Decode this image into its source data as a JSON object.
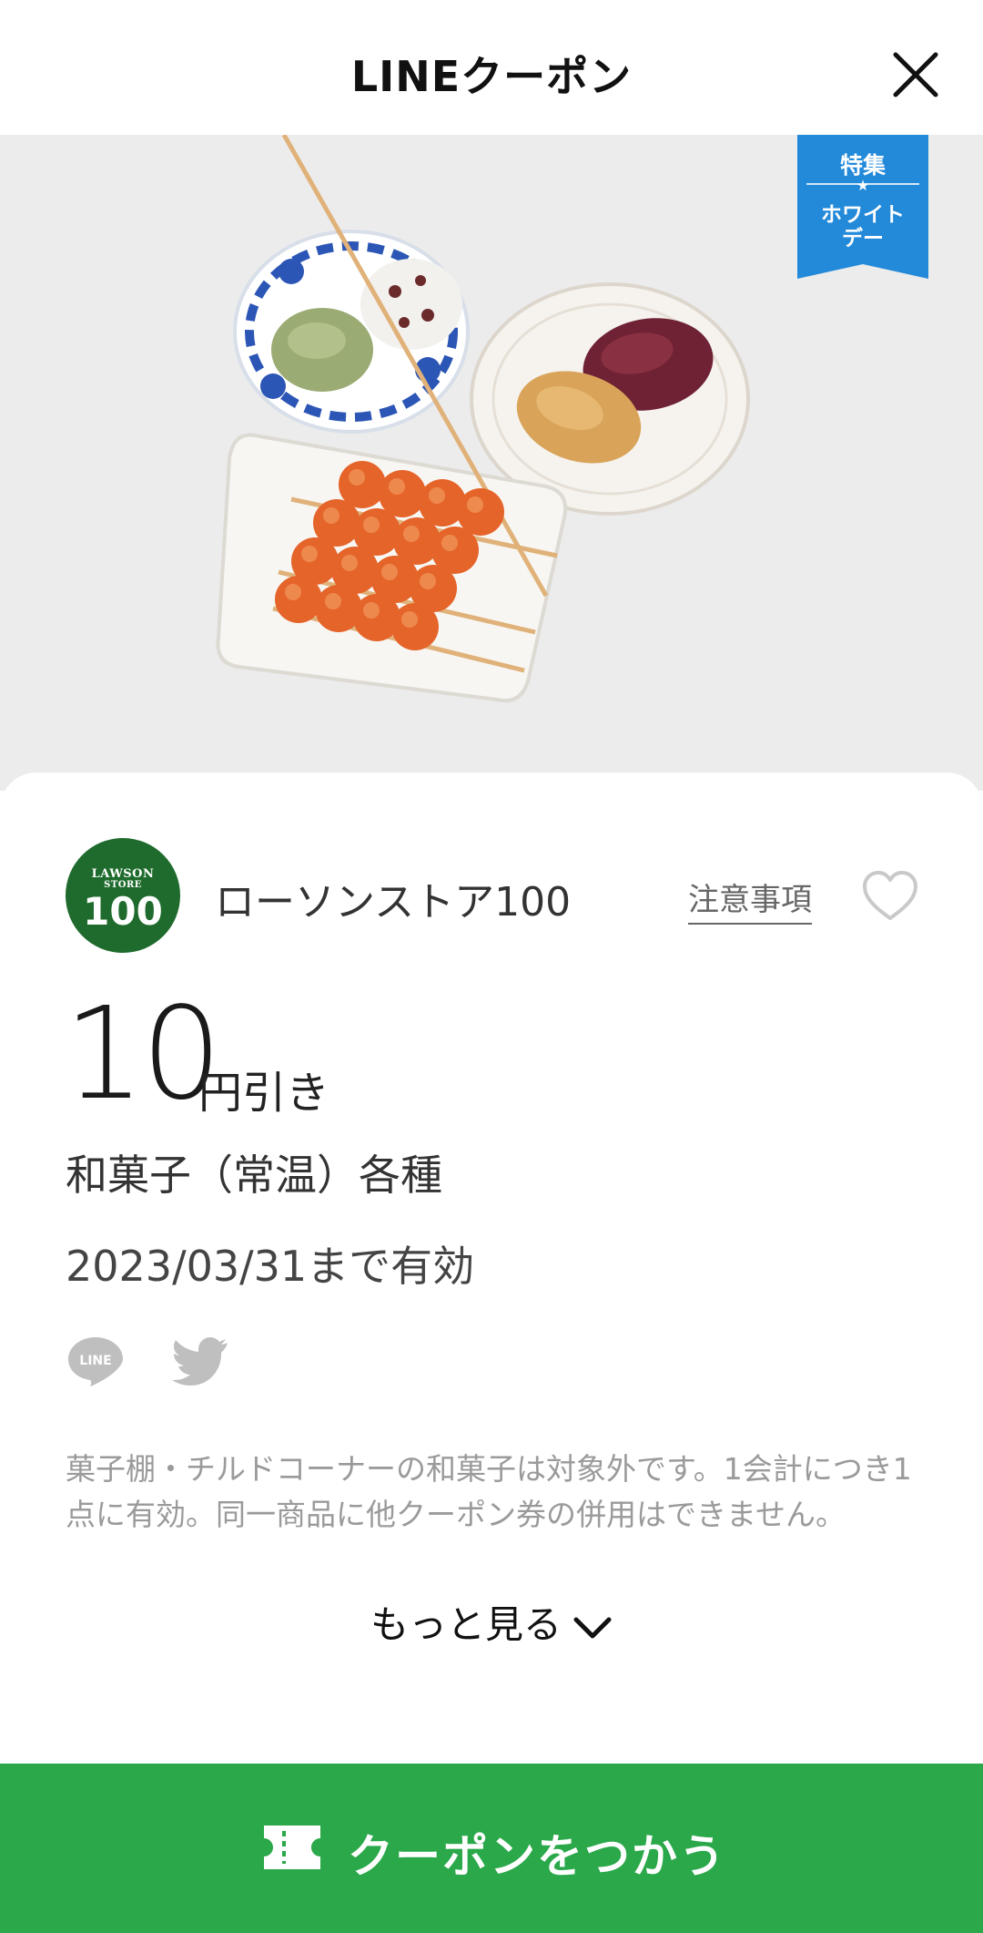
{
  "header": {
    "title": "LINEクーポン",
    "close_icon": "close-icon"
  },
  "hero": {
    "badge": {
      "top": "特集",
      "star": "★",
      "line1": "ホワイト",
      "line2": "デー",
      "color": "#2389d9"
    }
  },
  "store": {
    "logo_text1": "LAWSON",
    "logo_text2": "STORE",
    "logo_number": "100",
    "name": "ローソンストア100",
    "notice_label": "注意事項",
    "favorite_icon": "heart-outline-icon"
  },
  "coupon": {
    "amount": "10",
    "unit": "円引き",
    "product": "和菓子（常温）各種",
    "validity": "2023/03/31まで有効",
    "description": "菓子棚・チルドコーナーの和菓子は対象外です。1会計につき1点に有効。同一商品に他クーポン券の併用はできません。",
    "more_label": "もっと見る"
  },
  "share": {
    "line_icon": "line-share-icon",
    "line_label": "LINE",
    "twitter_icon": "twitter-icon"
  },
  "footer": {
    "use_label": "クーポンをつかう",
    "button_color": "#2aa84a"
  }
}
